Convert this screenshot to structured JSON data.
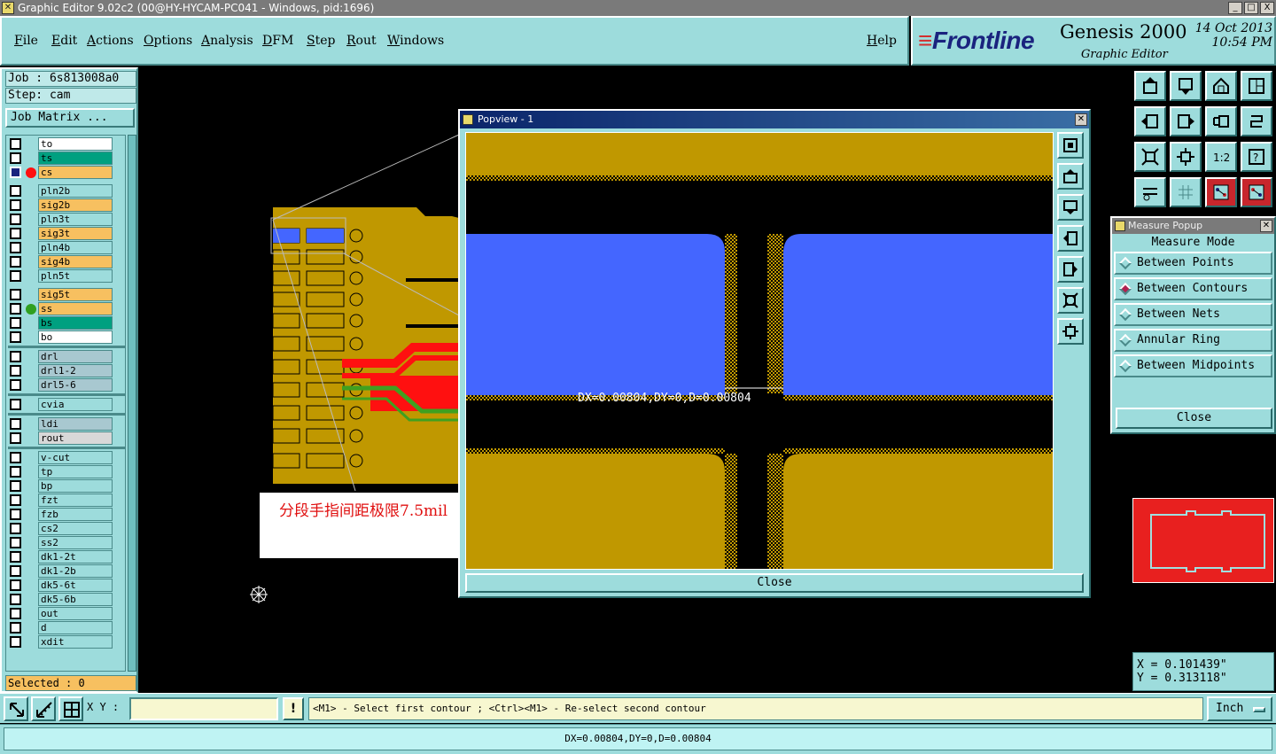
{
  "window": {
    "title": "Graphic Editor 9.02c2 (00@HY-HYCAM-PC041 - Windows, pid:1696)",
    "buttons": [
      "_",
      "□",
      "X"
    ]
  },
  "menubar": {
    "items": [
      "File",
      "Edit",
      "Actions",
      "Options",
      "Analysis",
      "DFM",
      "Step",
      "Rout",
      "Windows"
    ],
    "help": "Help"
  },
  "brand": {
    "logo": "Frontline",
    "product": "Genesis 2000",
    "subtitle": "Graphic Editor",
    "date": "14 Oct 2013",
    "time": "10:54 PM"
  },
  "leftpanel": {
    "job": "Job : 6s813008a0",
    "step": "Step: cam",
    "job_matrix": "Job Matrix ...",
    "selected": "Selected : 0",
    "layers": [
      {
        "name": "to",
        "color": "#ffffff"
      },
      {
        "name": "ts",
        "color": "#00a080"
      },
      {
        "name": "cs",
        "color": "#f7c060",
        "active": true
      },
      {
        "name": "pln2b",
        "color": "#9ddcdc"
      },
      {
        "name": "sig2b",
        "color": "#f7c060"
      },
      {
        "name": "pln3t",
        "color": "#9ddcdc"
      },
      {
        "name": "sig3t",
        "color": "#f7c060"
      },
      {
        "name": "pln4b",
        "color": "#9ddcdc"
      },
      {
        "name": "sig4b",
        "color": "#f7c060"
      },
      {
        "name": "pln5t",
        "color": "#9ddcdc"
      },
      {
        "name": "sig5t",
        "color": "#f7c060"
      },
      {
        "name": "ss",
        "color": "#f7c060",
        "green": true
      },
      {
        "name": "bs",
        "color": "#00a080"
      },
      {
        "name": "bo",
        "color": "#ffffff"
      },
      {
        "name": "drl",
        "color": "#a8c8d0"
      },
      {
        "name": "drl1-2",
        "color": "#a8c8d0"
      },
      {
        "name": "drl5-6",
        "color": "#a8c8d0"
      },
      {
        "name": "cvia",
        "color": "#9ddcdc"
      },
      {
        "name": "ldi",
        "color": "#a8c8d0"
      },
      {
        "name": "rout",
        "color": "#d8d8d8"
      },
      {
        "name": "v-cut",
        "color": "#9ddcdc"
      },
      {
        "name": "tp",
        "color": "#9ddcdc"
      },
      {
        "name": "bp",
        "color": "#9ddcdc"
      },
      {
        "name": "fzt",
        "color": "#9ddcdc"
      },
      {
        "name": "fzb",
        "color": "#9ddcdc"
      },
      {
        "name": "cs2",
        "color": "#9ddcdc"
      },
      {
        "name": "ss2",
        "color": "#9ddcdc"
      },
      {
        "name": "dk1-2t",
        "color": "#9ddcdc"
      },
      {
        "name": "dk1-2b",
        "color": "#9ddcdc"
      },
      {
        "name": "dk5-6t",
        "color": "#9ddcdc"
      },
      {
        "name": "dk5-6b",
        "color": "#9ddcdc"
      },
      {
        "name": "out",
        "color": "#9ddcdc"
      },
      {
        "name": "d",
        "color": "#9ddcdc"
      },
      {
        "name": "xdit",
        "color": "#9ddcdc"
      }
    ]
  },
  "popview": {
    "title": "Popview - 1",
    "measurement": "DX=0.00804,DY=0,D=0.00804",
    "close": "Close"
  },
  "measure_popup": {
    "title": "Measure Popup",
    "mode_label": "Measure Mode",
    "options": [
      {
        "label": "Between Points",
        "selected": false
      },
      {
        "label": "Between Contours",
        "selected": true
      },
      {
        "label": "Between Nets",
        "selected": false
      },
      {
        "label": "Annular Ring",
        "selected": false
      },
      {
        "label": "Between Midpoints",
        "selected": false
      }
    ],
    "close": "Close"
  },
  "annotation": {
    "text": "分段手指间距极限7.5mil"
  },
  "coords": {
    "x": "X = 0.101439\"",
    "y": "Y = 0.313118\""
  },
  "bottombar": {
    "xy_label": "X Y :",
    "xy_value": "",
    "bang": "!",
    "prompt": "<M1> - Select first contour ; <Ctrl><M1> - Re-select second contour",
    "unit": "Inch"
  },
  "status": {
    "text": "DX=0.00804,DY=0,D=0.00804"
  },
  "colors": {
    "panel": "#9ddcdc",
    "copper": "#c09800",
    "blue_pad": "#4466ff",
    "red_trace": "#ff1010",
    "green_trace": "#40a020"
  }
}
